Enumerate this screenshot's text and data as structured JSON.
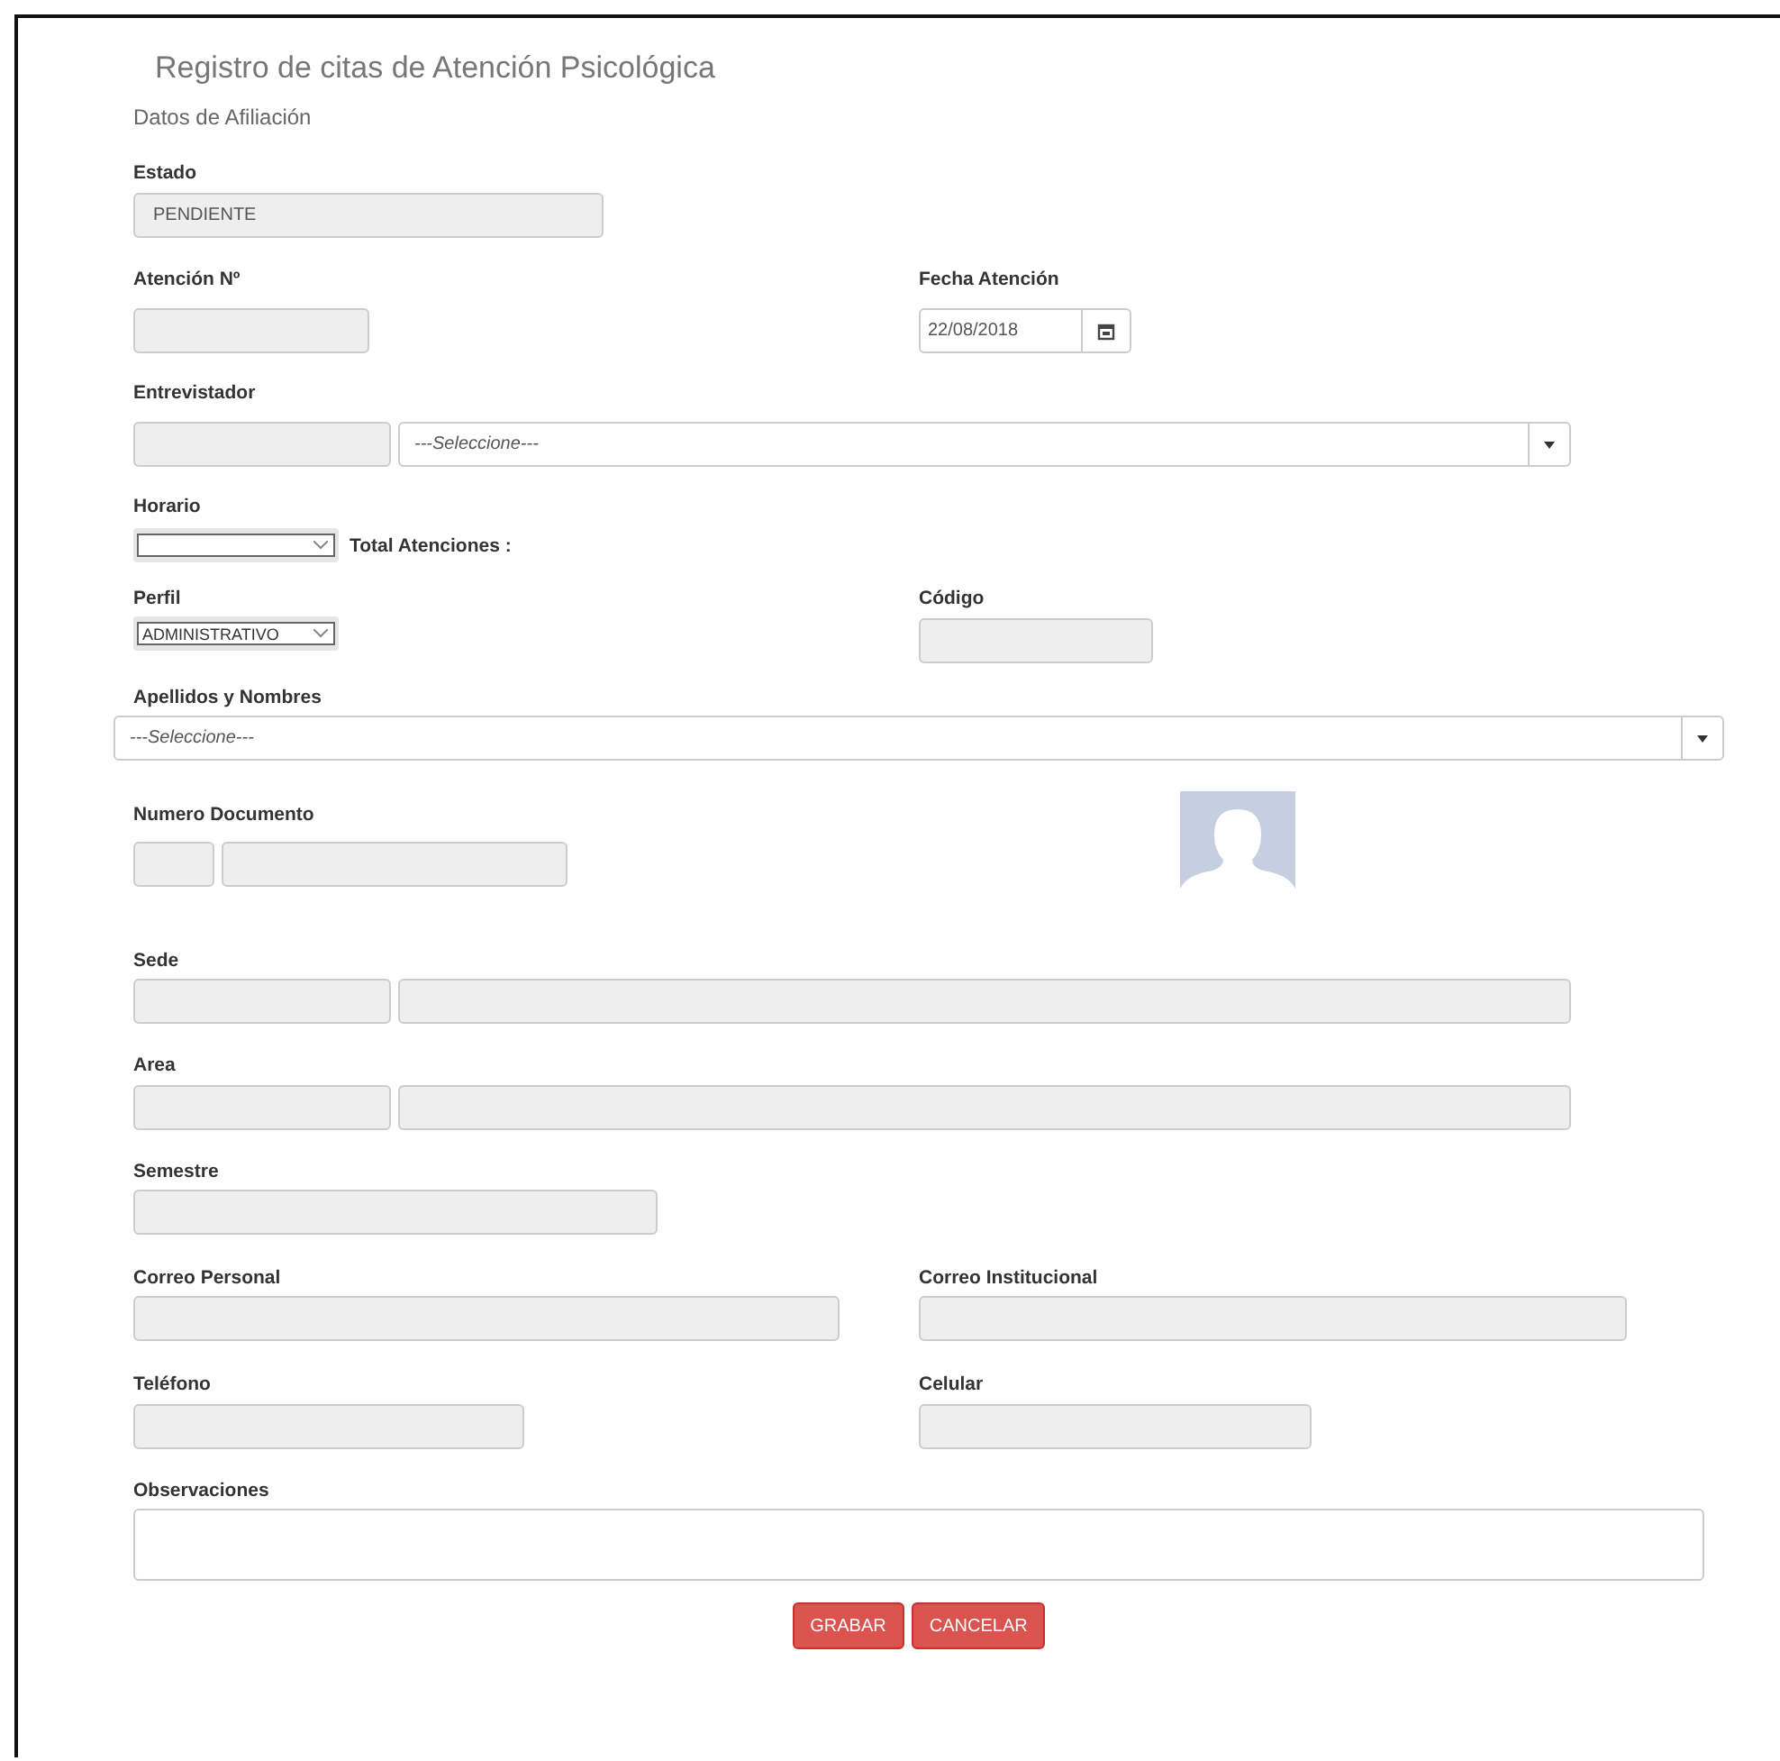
{
  "title": "Registro de citas de Atención Psicológica",
  "subtitle": "Datos de Afiliación",
  "estado": {
    "label": "Estado",
    "value": "PENDIENTE"
  },
  "atencion": {
    "label": "Atención Nº"
  },
  "fecha": {
    "label": "Fecha Atención",
    "value": "22/08/2018"
  },
  "entrevistador": {
    "label": "Entrevistador",
    "select_value": "---Seleccione---"
  },
  "horario": {
    "label": "Horario",
    "total_label": "Total Atenciones :"
  },
  "perfil": {
    "label": "Perfil",
    "value": "ADMINISTRATIVO"
  },
  "codigo": {
    "label": "Código"
  },
  "apellidos": {
    "label": "Apellidos y Nombres",
    "select_value": "---Seleccione---"
  },
  "numero_documento": {
    "label": "Numero Documento"
  },
  "sede": {
    "label": "Sede"
  },
  "area": {
    "label": "Area"
  },
  "semestre": {
    "label": "Semestre"
  },
  "correo_personal": {
    "label": "Correo Personal"
  },
  "correo_institucional": {
    "label": "Correo Institucional"
  },
  "telefono": {
    "label": "Teléfono"
  },
  "celular": {
    "label": "Celular"
  },
  "observaciones": {
    "label": "Observaciones"
  },
  "buttons": [
    "GRABAR",
    "CANCELAR"
  ]
}
